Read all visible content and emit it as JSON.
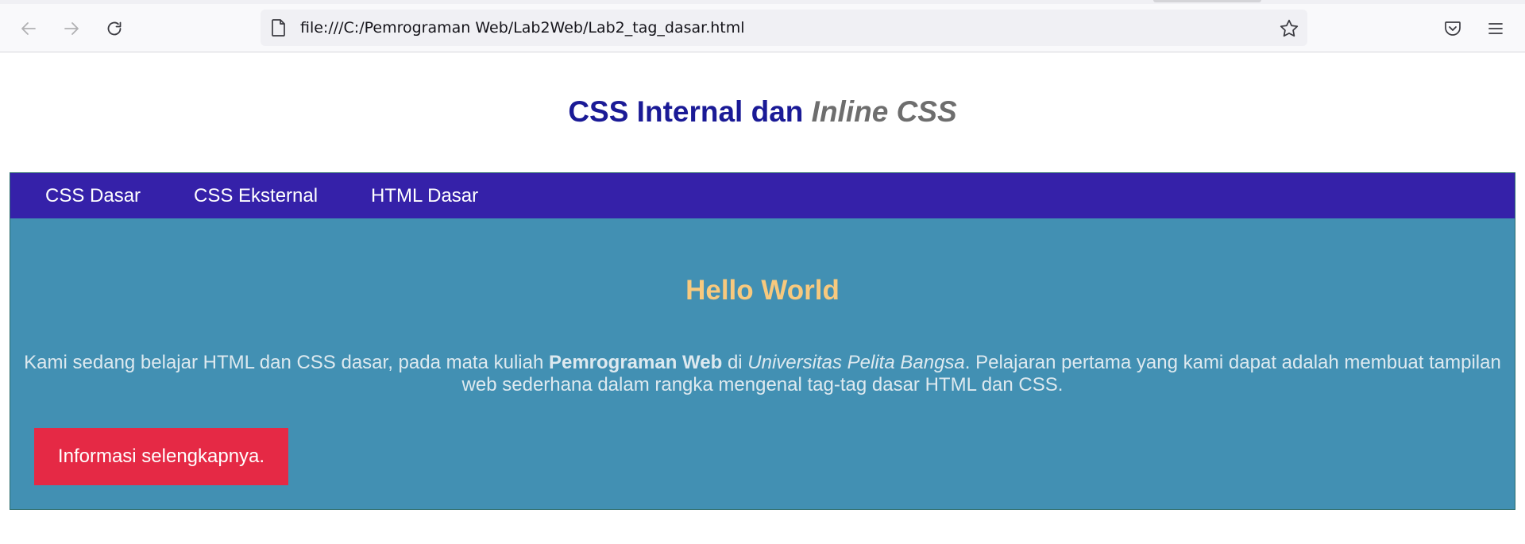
{
  "browser": {
    "url": "file:///C:/Pemrograman Web/Lab2Web/Lab2_tag_dasar.html",
    "icons": {
      "back": "back-arrow-icon",
      "forward": "forward-arrow-icon",
      "reload": "reload-icon",
      "page": "page-icon",
      "bookmark": "star-icon",
      "pocket": "pocket-icon",
      "menu": "hamburger-menu-icon"
    }
  },
  "page": {
    "title_main": "CSS Internal dan ",
    "title_italic": "Inline",
    "title_end": " CSS",
    "nav": {
      "items": [
        {
          "label": "CSS Dasar"
        },
        {
          "label": "CSS Eksternal"
        },
        {
          "label": "HTML Dasar"
        }
      ]
    },
    "hero": {
      "title": "Hello World",
      "text_part1": "Kami sedang belajar HTML dan CSS dasar, pada mata kuliah ",
      "text_bold": "Pemrograman Web",
      "text_part2": " di ",
      "text_italic": "Universitas Pelita Bangsa",
      "text_part3": ". Pelajaran pertama yang kami dapat adalah membuat tampilan web sederhana dalam rangka mengenal tag-tag dasar HTML dan CSS.",
      "button_label": "Informasi selengkapnya."
    }
  },
  "colors": {
    "title": "#1a1a96",
    "title_italic": "#6e6e6e",
    "navbar": "#3521a9",
    "container": "#4290b3",
    "hero_title": "#f7c97e",
    "hero_text": "#dde9ef",
    "button": "#e52945"
  }
}
